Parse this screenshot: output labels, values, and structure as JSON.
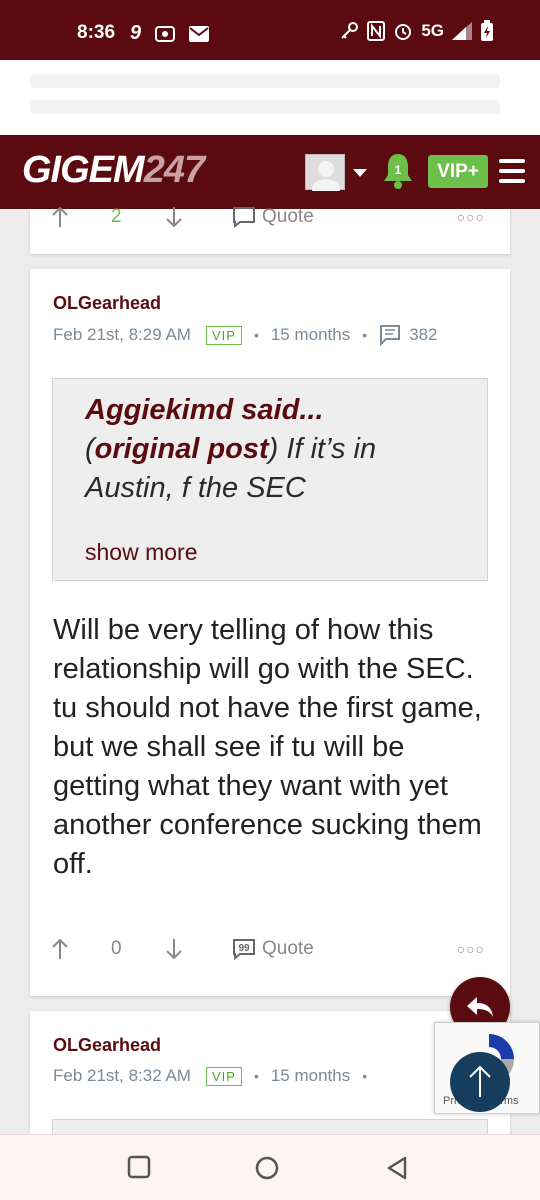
{
  "status_bar": {
    "time": "8:36",
    "network": "5G",
    "icons": [
      "signal-9-icon",
      "cast-icon",
      "mail-icon",
      "key-icon",
      "nfc-icon",
      "alarm-icon",
      "signal-icon",
      "battery-charging-icon"
    ]
  },
  "nav": {
    "logo_main": "GIGEM",
    "logo_num": "247",
    "notification_count": "1",
    "vip_label": "VIP+"
  },
  "prev_post": {
    "upvotes": "2",
    "quote_label": "Quote"
  },
  "post": {
    "author": "OLGearhead",
    "date": "Feb 21st, 8:29 AM",
    "badge": "VIP",
    "member_for": "15 months",
    "post_count": "382",
    "quote": {
      "author_said": "Aggiekimd said...",
      "op_label": "original post",
      "text": " If it’s in Austin, f the SEC",
      "show_more": "show more"
    },
    "body": "Will be very telling of how this relationship will go with the SEC. tu should not have the first game, but we shall see if tu will be getting what they want with yet another conference sucking them off.",
    "upvotes": "0",
    "quote_label": "Quote"
  },
  "next_post": {
    "author": "OLGearhead",
    "date": "Feb 21st, 8:32 AM",
    "badge": "VIP",
    "member_for": "15 months"
  },
  "recaptcha": {
    "text": "Privacy - Terms"
  },
  "colors": {
    "brand": "#5b0b10",
    "vip_green": "#6cc04a",
    "scroll_top": "#163d5c"
  }
}
